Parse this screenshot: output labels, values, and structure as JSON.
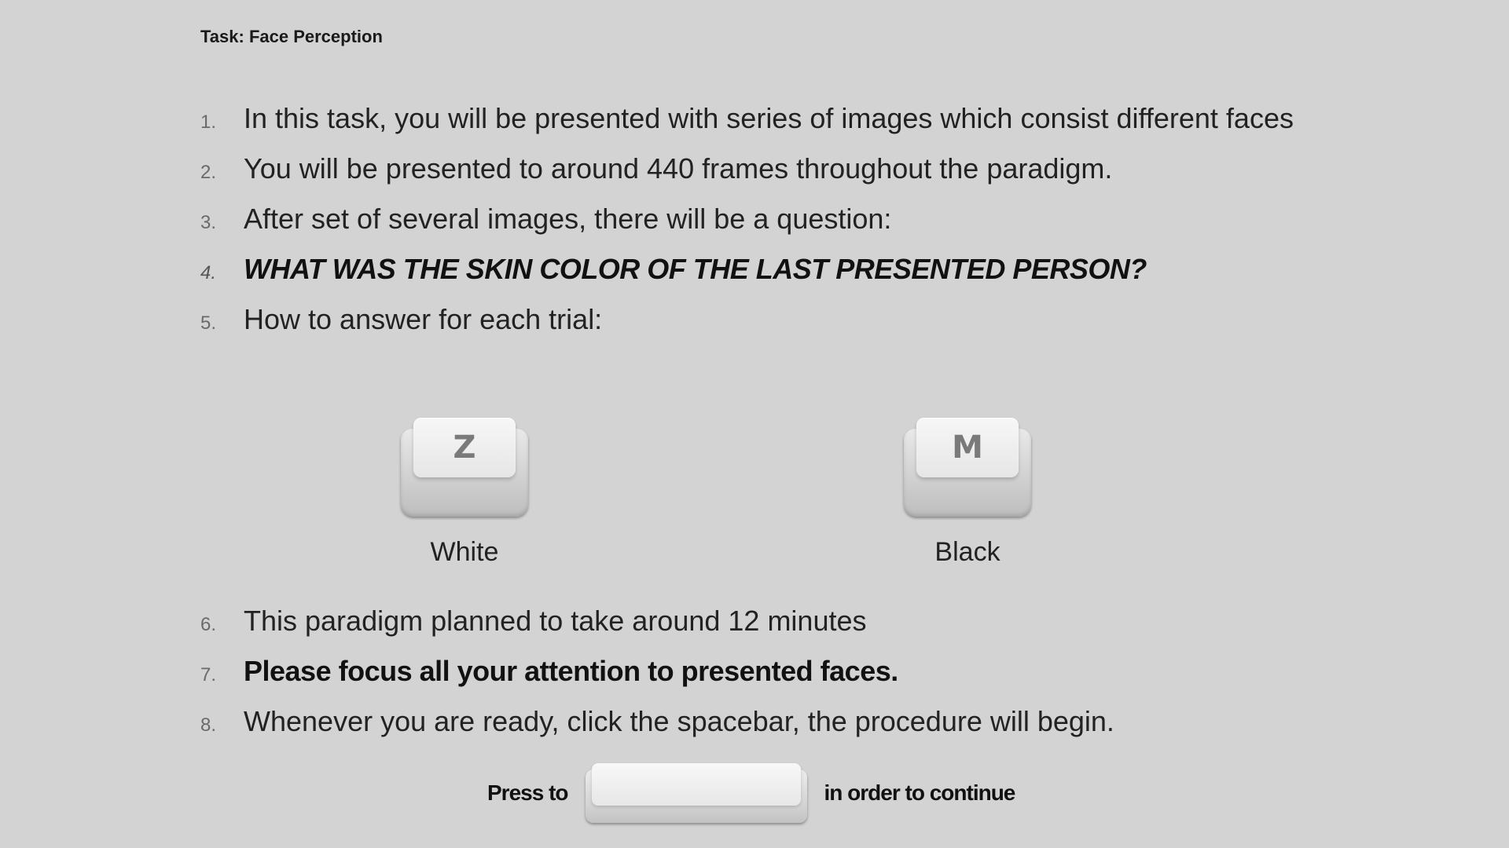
{
  "task": {
    "title": "Task: Face Perception"
  },
  "instructions_first": [
    {
      "number": "1.",
      "text": "In this task, you will be presented with series of images which consist different faces"
    },
    {
      "number": "2.",
      "text": "You will be presented to around 440 frames throughout the paradigm."
    },
    {
      "number": "3.",
      "text": "After set of several images, there will be a question:"
    },
    {
      "number": "4.",
      "text": "WHAT WAS THE SKIN COLOR OF THE LAST PRESENTED PERSON?"
    },
    {
      "number": "5.",
      "text": "How to answer for each trial:"
    }
  ],
  "response_keys": [
    {
      "key": "Z",
      "label": "White"
    },
    {
      "key": "M",
      "label": "Black"
    }
  ],
  "instructions_second": [
    {
      "number": "6.",
      "text": "This paradigm planned to take around 12 minutes"
    },
    {
      "number": "7.",
      "text": "Please focus all your attention to presented faces."
    },
    {
      "number": "8.",
      "text": "Whenever you are ready, click the spacebar, the procedure will begin."
    }
  ],
  "continue_prompt": {
    "before": "Press to",
    "after": "in order to continue"
  }
}
